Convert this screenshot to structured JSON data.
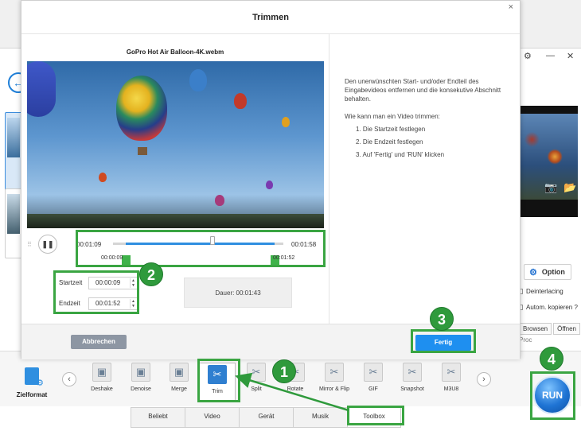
{
  "dialog": {
    "title": "Trimmen",
    "close_glyph": "×",
    "file_name": "GoPro Hot Air Balloon-4K.webm",
    "info_text": "Den unerwünschten Start- und/oder Endteil des Eingabevideos entfernen und die konsekutive Abschnitt behalten.",
    "help_title": "Wie kann man ein Video trimmen:",
    "steps": [
      "1. Die Startzeit festlegen",
      "2. Die Endzeit festlegen",
      "3. Auf 'Fertig' und 'RUN' klicken"
    ],
    "player": {
      "play_glyph": "❚❚",
      "current_time": "00:01:09",
      "total_time": "00:01:58",
      "start_handle_time": "00:00:09",
      "end_handle_time": "00:01:52",
      "selection_start_fraction": 0.076,
      "selection_end_fraction": 0.949,
      "playhead_fraction": 0.585
    },
    "start_label": "Startzeit",
    "start_value": "00:00:09",
    "end_label": "Endzeit",
    "end_value": "00:01:52",
    "duration_text": "Dauer:  00:01:43",
    "cancel_label": "Abbrechen",
    "done_label": "Fertig"
  },
  "app": {
    "back_glyph": "←",
    "settings_glyph": "⚙",
    "option_label": "Option",
    "deinterlacing_label": "Deinterlacing",
    "auto_copy_label": "Autom. kopieren ?",
    "browse_label": "Browsen",
    "open_label": "Öffnen",
    "proc_label": "Proc",
    "zielformat_label": "Zielformat",
    "run_label": "RUN",
    "tools": [
      {
        "name": "deshake",
        "label": "Deshake",
        "glyph": "▣"
      },
      {
        "name": "denoise",
        "label": "Denoise",
        "glyph": "▣"
      },
      {
        "name": "merge",
        "label": "Merge",
        "glyph": "▣"
      },
      {
        "name": "trim",
        "label": "Trim",
        "glyph": "✂"
      },
      {
        "name": "split",
        "label": "Split",
        "glyph": "✂"
      },
      {
        "name": "rotate",
        "label": "Rotate",
        "glyph": "✂"
      },
      {
        "name": "mirror-flip",
        "label": "Mirror & Flip",
        "glyph": "✂"
      },
      {
        "name": "gif",
        "label": "GIF",
        "glyph": "✂"
      },
      {
        "name": "snapshot",
        "label": "Snapshot",
        "glyph": "✂"
      },
      {
        "name": "m3u8",
        "label": "M3U8",
        "glyph": "✂"
      }
    ],
    "tabs": [
      "Beliebt",
      "Video",
      "Gerät",
      "Musik",
      "Toolbox"
    ],
    "active_tab": "Toolbox"
  },
  "annotations": {
    "badges": [
      "1",
      "2",
      "3",
      "4"
    ],
    "highlight_color": "#3aa542",
    "badge_color": "#2f9a3c"
  },
  "colors": {
    "accent_blue": "#1e8ff0",
    "handle_green": "#3fb24a",
    "cancel_gray": "#8d96a3"
  }
}
